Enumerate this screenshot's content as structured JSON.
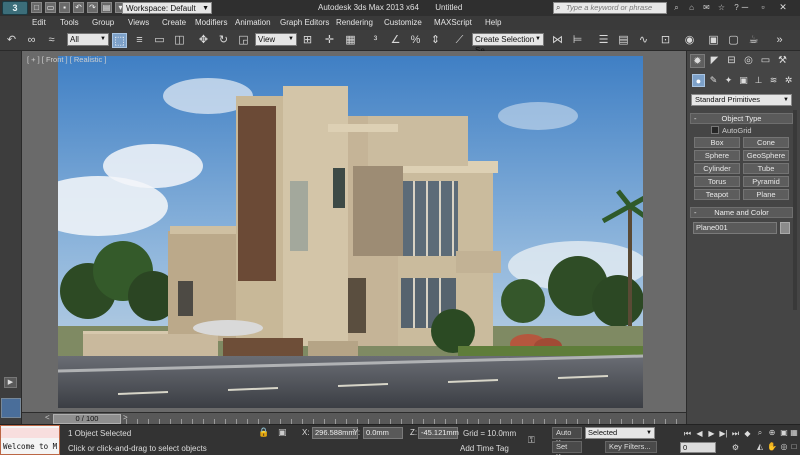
{
  "app": {
    "logo": "3",
    "workspace_label": "Workspace: Default",
    "title": "Autodesk 3ds Max  2013 x64",
    "document": "Untitled",
    "search_placeholder": "Type a keyword or phrase"
  },
  "menu": [
    "Edit",
    "Tools",
    "Group",
    "Views",
    "Create",
    "Modifiers",
    "Animation",
    "Graph Editors",
    "Rendering",
    "Customize",
    "MAXScript",
    "Help"
  ],
  "toolbar": {
    "selection_filter": "All",
    "reference_coord": "View",
    "named_selection": "Create Selection Se"
  },
  "viewport": {
    "label": "[ + ] [ Front ] [ Realistic ]"
  },
  "timeline": {
    "position": "0 / 100",
    "prev": "<",
    "next": ">"
  },
  "status": {
    "selection_info": "1 Object Selected",
    "prompt": "Click or click-and-drag to select objects",
    "x_label": "X:",
    "x_value": "296.588mm",
    "y_label": "Y:",
    "y_value": "0.0mm",
    "z_label": "Z:",
    "z_value": "-45.121mm",
    "grid": "Grid = 10.0mm",
    "add_time_tag": "Add Time Tag",
    "auto_key": "Auto Key",
    "set_key": "Set Key",
    "key_mode": "Selected",
    "key_filters": "Key Filters...",
    "frame": "0",
    "maxscript_text": "Welcome to M"
  },
  "command_panel": {
    "category": "Standard Primitives",
    "object_type_title": "Object Type",
    "autogrid_label": "AutoGrid",
    "primitives": [
      "Box",
      "Cone",
      "Sphere",
      "GeoSphere",
      "Cylinder",
      "Tube",
      "Torus",
      "Pyramid",
      "Teapot",
      "Plane"
    ],
    "name_color_title": "Name and Color",
    "object_name": "Plane001",
    "object_color": "#8b8b8b"
  },
  "colors": {
    "active_button": "#7da1c9",
    "ui_dark": "#3d3d3d",
    "sky_top": "#3f7fc4",
    "house_wall": "#c9b99b",
    "brick": "#6b4a36"
  }
}
